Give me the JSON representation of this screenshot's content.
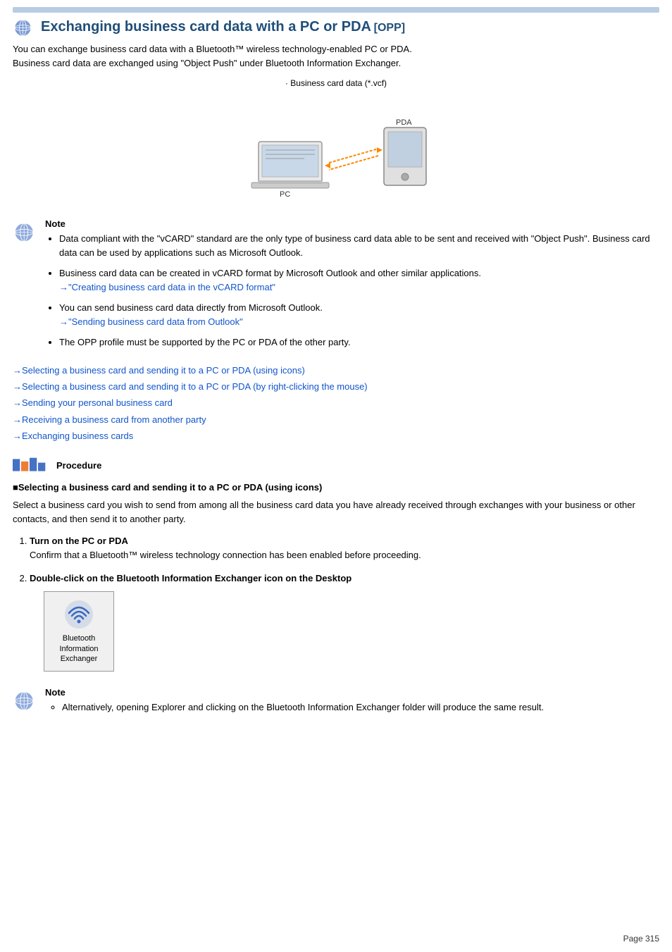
{
  "topbar": {},
  "header": {
    "title": "Exchanging business card data with a PC or PDA",
    "opp_label": "[OPP]",
    "intro_line1": "You can exchange business card data with a Bluetooth™ wireless technology-enabled PC or PDA.",
    "intro_line2": "Business card data are exchanged using \"Object Push\" under Bluetooth Information Exchanger."
  },
  "diagram": {
    "caption": "· Business card data (*.vcf)"
  },
  "note1": {
    "label": "Note",
    "items": [
      "Data compliant with the \"vCARD\" standard are the only type of business card data able to be sent and received with \"Object Push\". Business card data can be used by applications such as Microsoft Outlook.",
      "Business card data can be created in vCARD format by Microsoft Outlook and other similar applications.",
      "You can send business card data directly from Microsoft Outlook.",
      "The OPP profile must be supported by the PC or PDA of the other party."
    ],
    "link_vcf": "→\"Creating business card data in the vCARD format\"",
    "link_outlook": "→\"Sending business card data from Outlook\""
  },
  "nav_links": {
    "items": [
      "→Selecting a business card and sending it to a PC or PDA (using icons)",
      "→Selecting a business card and sending it to a PC or PDA (by right-clicking the mouse)",
      "→Sending your personal business card",
      "→Receiving a business card from another party",
      "→Exchanging business cards"
    ]
  },
  "procedure": {
    "label": "Procedure",
    "section_heading": "■Selecting a business card and sending it to a PC or PDA (using icons)",
    "section_desc": "Select a business card you wish to send from among all the business card data you have already received through exchanges with your business or other contacts, and then send it to another party.",
    "steps": [
      {
        "number": "1.",
        "title": "Turn on the PC or PDA",
        "desc": "Confirm that a Bluetooth™ wireless technology connection has been enabled before proceeding."
      },
      {
        "number": "2.",
        "title": "Double-click on the Bluetooth Information Exchanger icon on the Desktop",
        "desc": ""
      }
    ],
    "bt_icon_label": "Bluetooth\nInformation\nExchanger"
  },
  "note2": {
    "label": "Note",
    "items": [
      "Alternatively, opening Explorer and clicking on the Bluetooth Information Exchanger folder will produce the same result."
    ]
  },
  "page_number": "Page 315"
}
